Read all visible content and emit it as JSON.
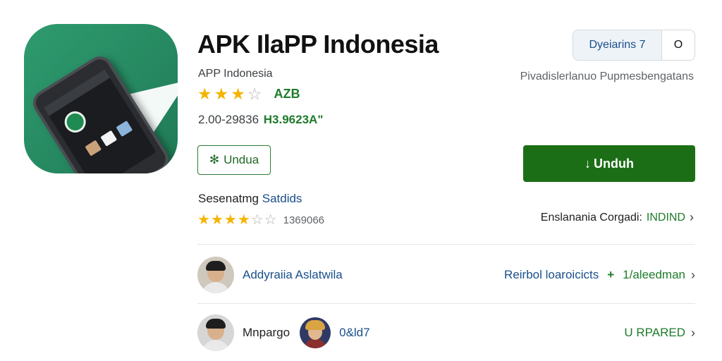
{
  "app": {
    "title": "APK IlaPP Indonesia",
    "developer": "APP Indonesia",
    "rating_stars": 3,
    "rating_max": 5,
    "rating_badge": "AZB",
    "meta_plain": "2.00-29836",
    "meta_green": "H3.9623A\""
  },
  "top_right": {
    "select_label": "Dyeiarins 7",
    "circle_label": "O",
    "subtitle": "Pivadislerlanuo Pupmesbengatans"
  },
  "buttons": {
    "outline_icon": "✻",
    "outline_label": "Undua",
    "primary_icon": "↓",
    "primary_label": "Unduh"
  },
  "reviews": {
    "title_plain": "Sesenatmg",
    "title_blue": "Satdids",
    "stars": 3.5,
    "count": "1369066",
    "link_plain": "Enslanania Corgadi:",
    "link_green": "INDIND"
  },
  "rows": [
    {
      "name": "Addyraiia Aslatwila",
      "right_blue": "Reirbol loaroicicts",
      "right_arrow": "+",
      "right_green": "1/aleedman"
    },
    {
      "name": "Mnpargo",
      "second_name": "0&ld7",
      "right_green": "U RPARED"
    }
  ],
  "icons": {
    "app_icon": "app-logo-phone",
    "chevron": "chevron-right-icon"
  },
  "colors": {
    "brand_green": "#1b6e16",
    "icon_green": "#2f9b6f",
    "link_blue": "#1a4f8b",
    "star_gold": "#f4b400"
  }
}
